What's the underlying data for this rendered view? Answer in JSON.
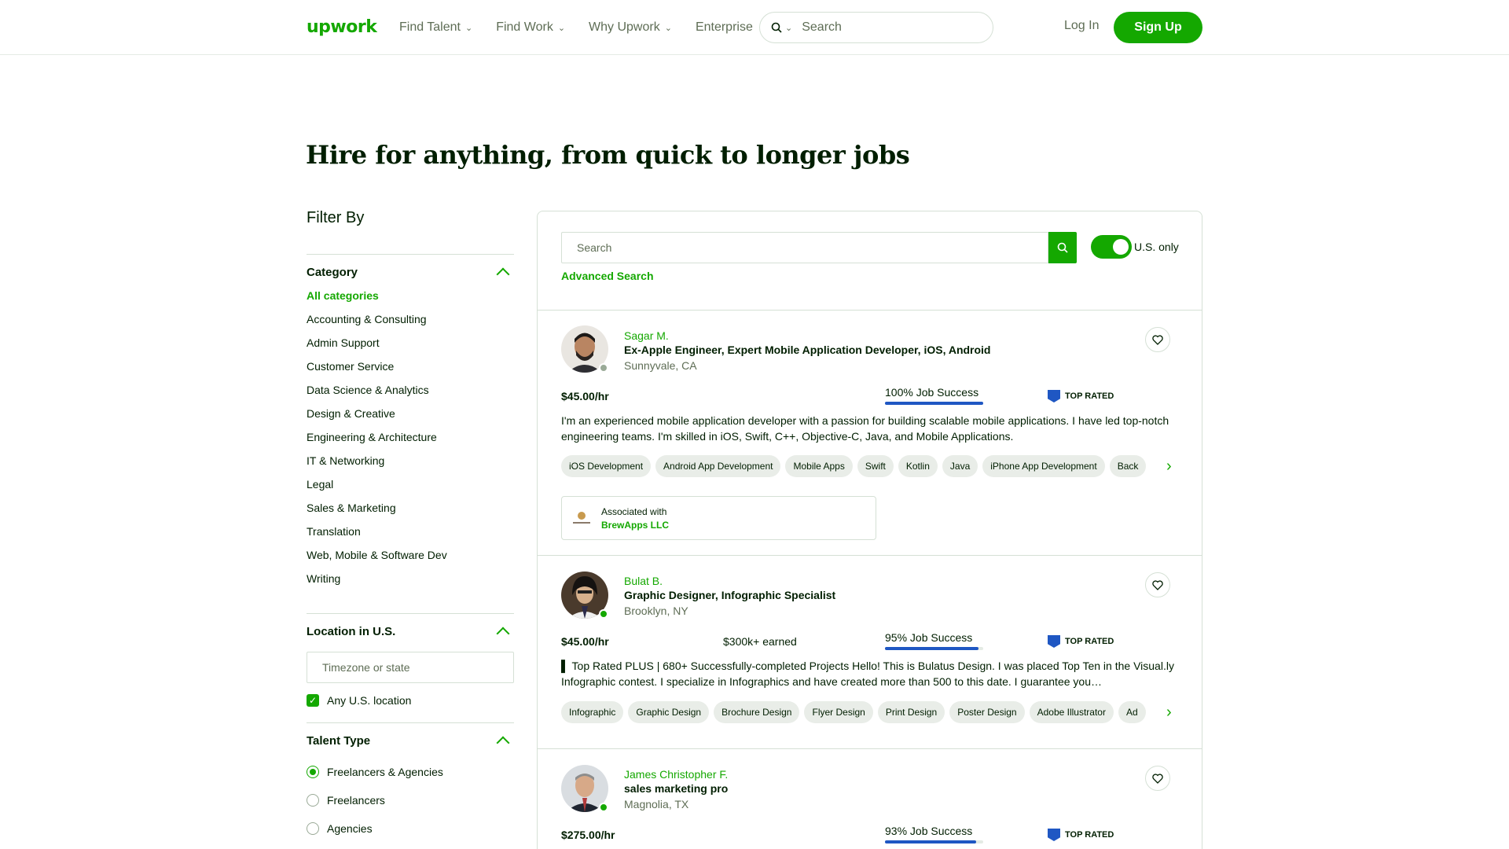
{
  "header": {
    "logo": "upwork",
    "nav": [
      {
        "label": "Find Talent",
        "has_caret": true
      },
      {
        "label": "Find Work",
        "has_caret": true
      },
      {
        "label": "Why Upwork",
        "has_caret": true
      },
      {
        "label": "Enterprise",
        "has_caret": false
      }
    ],
    "search_placeholder": "Search",
    "login": "Log In",
    "signup": "Sign Up"
  },
  "page_title": "Hire for anything, from quick to longer jobs",
  "sidebar": {
    "filter_title": "Filter By",
    "category": {
      "title": "Category",
      "items": [
        "All categories",
        "Accounting & Consulting",
        "Admin Support",
        "Customer Service",
        "Data Science & Analytics",
        "Design & Creative",
        "Engineering & Architecture",
        "IT & Networking",
        "Legal",
        "Sales & Marketing",
        "Translation",
        "Web, Mobile & Software Dev",
        "Writing"
      ],
      "active": "All categories"
    },
    "location": {
      "title": "Location in U.S.",
      "placeholder": "Timezone or state",
      "checkbox_label": "Any U.S. location",
      "checked": true
    },
    "talent_type": {
      "title": "Talent Type",
      "options": [
        "Freelancers & Agencies",
        "Freelancers",
        "Agencies"
      ],
      "selected": "Freelancers & Agencies"
    }
  },
  "results": {
    "search_placeholder": "Search",
    "toggle_label": "U.S. only",
    "toggle_on": true,
    "advanced_search": "Advanced Search",
    "freelancers": [
      {
        "name": "Sagar M.",
        "headline": "Ex-Apple Engineer, Expert Mobile Application Developer, iOS, Android",
        "location": "Sunnyvale, CA",
        "rate": "$45.00/hr",
        "earned": "",
        "job_success": "100% Job Success",
        "job_success_fraction": 1.0,
        "badge": "TOP RATED",
        "online": false,
        "description": "I'm an experienced mobile application developer with a passion for building scalable mobile applications. I have led top-notch engineering teams. I'm skilled in iOS, Swift, C++, Objective-C, Java, and Mobile Applications.",
        "skills": [
          "iOS Development",
          "Android App Development",
          "Mobile Apps",
          "Swift",
          "Kotlin",
          "Java",
          "iPhone App Development",
          "Back"
        ],
        "associated": {
          "label": "Associated with",
          "agency": "BrewApps LLC"
        }
      },
      {
        "name": "Bulat B.",
        "headline": "Graphic Designer, Infographic Specialist",
        "location": "Brooklyn, NY",
        "rate": "$45.00/hr",
        "earned": "$300k+ earned",
        "job_success": "95% Job Success",
        "job_success_fraction": 0.95,
        "badge": "TOP RATED",
        "online": true,
        "description": "▌ Top Rated PLUS | 680+ Successfully-completed Projects Hello! This is Bulatus Design. I was placed Top Ten in the Visual.ly Infographic contest. I specialize in Infographics and have created more than 500 to this date. I guarantee you…",
        "skills": [
          "Infographic",
          "Graphic Design",
          "Brochure Design",
          "Flyer Design",
          "Print Design",
          "Poster Design",
          "Adobe Illustrator",
          "Ad"
        ]
      },
      {
        "name": "James Christopher F.",
        "headline": "sales marketing pro",
        "location": "Magnolia, TX",
        "rate": "$275.00/hr",
        "earned": "",
        "job_success": "93% Job Success",
        "job_success_fraction": 0.93,
        "badge": "TOP RATED",
        "online": true
      }
    ]
  },
  "colors": {
    "brand_green": "#14a800",
    "job_success_blue": "#1f57c3",
    "text": "#001e00",
    "muted": "#5e6d55"
  }
}
